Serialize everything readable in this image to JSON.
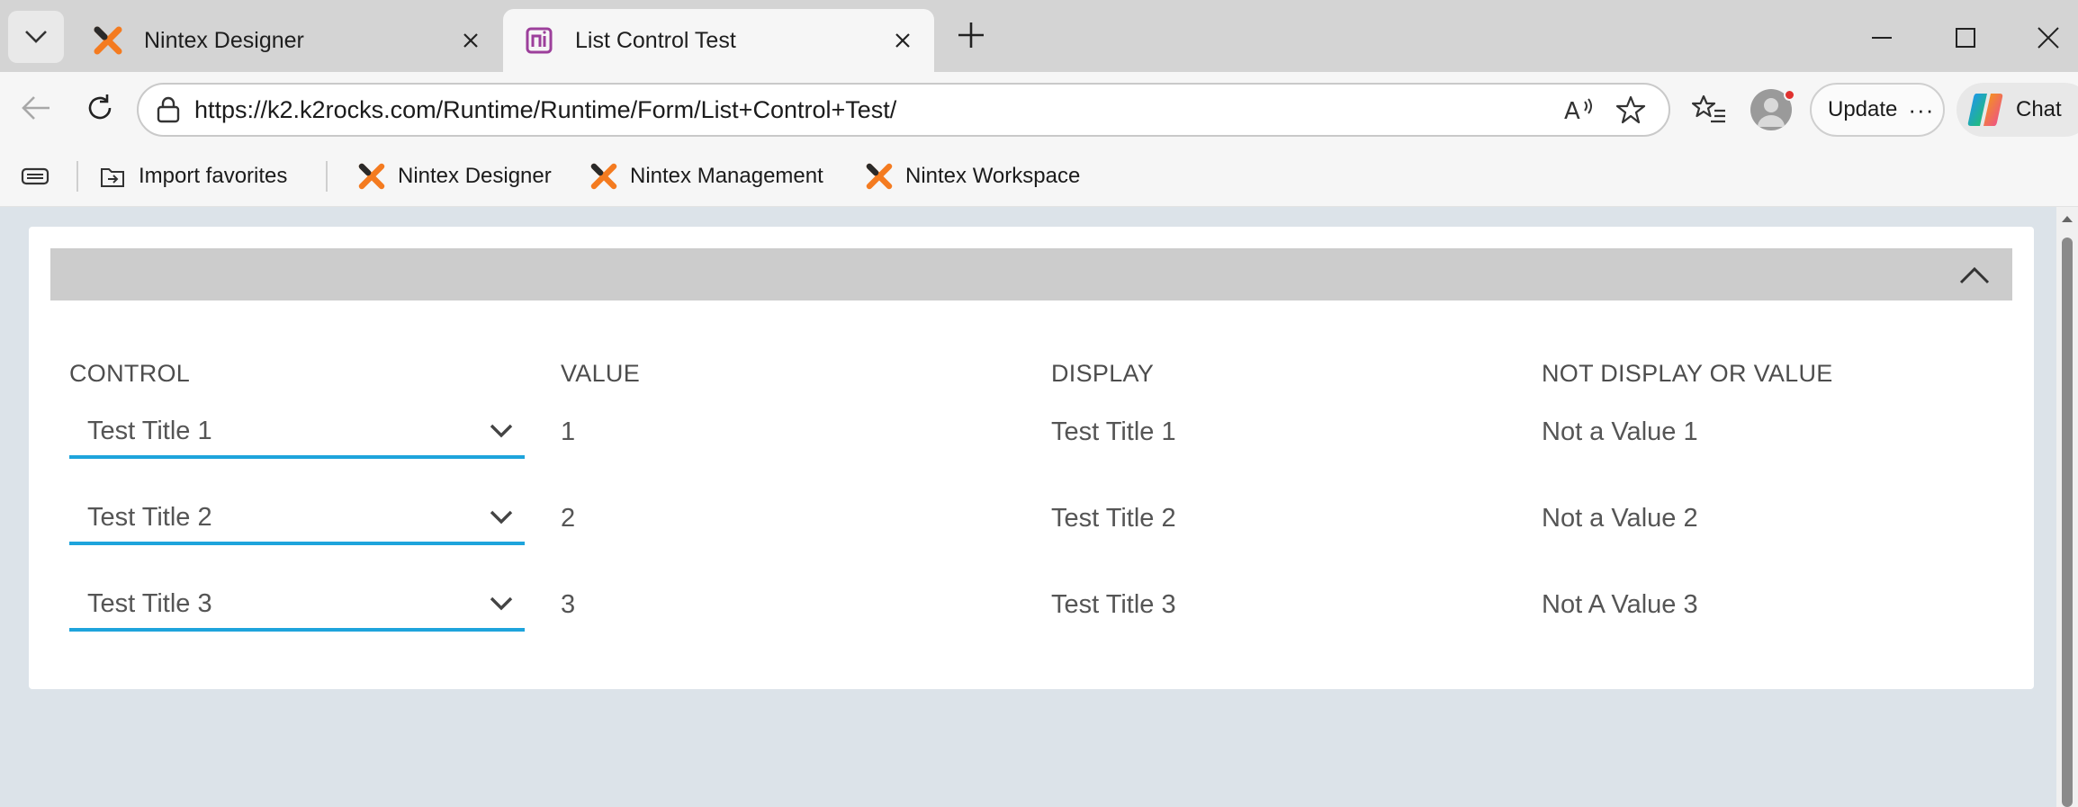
{
  "browser": {
    "tabs": [
      {
        "label": "Nintex Designer",
        "icon": "nintex-x-icon",
        "active": false
      },
      {
        "label": "List Control Test",
        "icon": "nintex-n-icon",
        "active": true
      }
    ],
    "address_url": "https://k2.k2rocks.com/Runtime/Runtime/Form/List+Control+Test/",
    "update_label": "Update",
    "update_dots": "···",
    "chat_label": "Chat",
    "favorites": [
      {
        "label": "Import favorites",
        "icon": "import-favorites-icon"
      },
      {
        "label": "Nintex Designer",
        "icon": "nintex-x-icon"
      },
      {
        "label": "Nintex Management",
        "icon": "nintex-x-icon"
      },
      {
        "label": "Nintex Workspace",
        "icon": "nintex-x-icon"
      }
    ]
  },
  "form": {
    "columns": [
      "CONTROL",
      "VALUE",
      "DISPLAY",
      "NOT DISPLAY OR VALUE"
    ],
    "rows": [
      {
        "control": "Test Title 1",
        "value": "1",
        "display": "Test Title 1",
        "not_display_or_value": "Not a Value 1"
      },
      {
        "control": "Test Title 2",
        "value": "2",
        "display": "Test Title 2",
        "not_display_or_value": "Not a Value 2"
      },
      {
        "control": "Test Title 3",
        "value": "3",
        "display": "Test Title 3",
        "not_display_or_value": "Not A Value 3"
      }
    ]
  },
  "colors": {
    "accent_underline": "#1ea4dc",
    "nintex_orange": "#f47b20",
    "page_background": "#dce3e9",
    "header_bar": "#cccccc"
  }
}
